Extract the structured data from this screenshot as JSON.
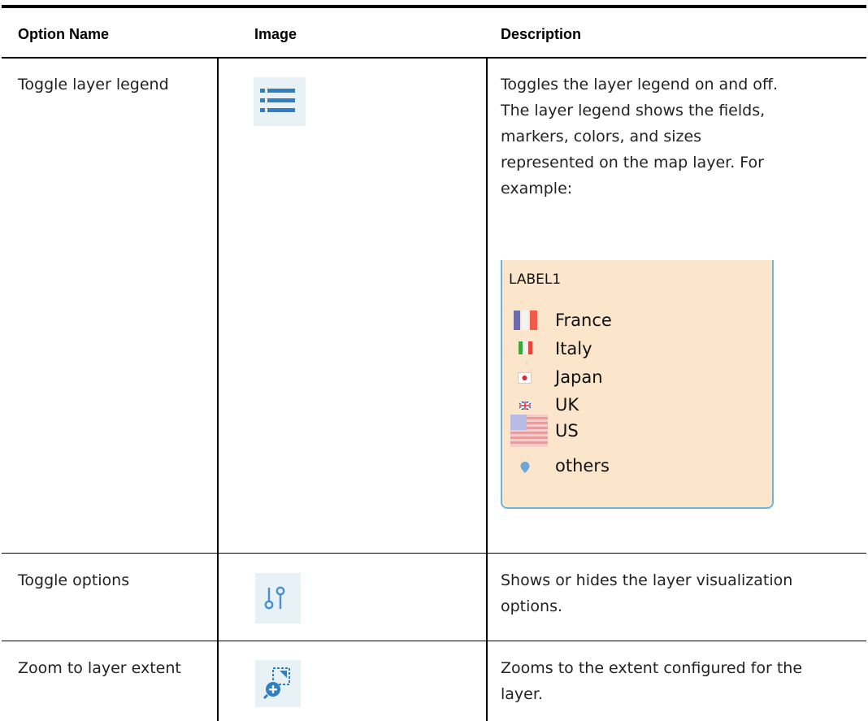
{
  "table": {
    "headers": {
      "option_name": "Option Name",
      "image": "Image",
      "description": "Description"
    },
    "rows": [
      {
        "option_name": "Toggle layer legend",
        "icon": "list-icon",
        "description_lines": [
          "Toggles the layer legend on and off.",
          "The layer legend shows the fields,",
          "markers, colors, and sizes",
          "represented on the map layer. For",
          "example:"
        ]
      },
      {
        "option_name": "Toggle options",
        "icon": "options-icon",
        "description_lines": [
          "Shows or hides the layer visualization",
          "options."
        ]
      },
      {
        "option_name": "Zoom to layer extent",
        "icon": "zoom-extent-icon",
        "description_lines": [
          "Zooms to the extent configured for the",
          "layer."
        ]
      }
    ]
  },
  "legend_example": {
    "title": "LABEL1",
    "items": [
      {
        "label": "France",
        "marker": "france-flag-icon"
      },
      {
        "label": "Italy",
        "marker": "italy-flag-icon"
      },
      {
        "label": "Japan",
        "marker": "japan-flag-icon"
      },
      {
        "label": "UK",
        "marker": "uk-flag-icon"
      },
      {
        "label": "US",
        "marker": "us-flag-icon"
      },
      {
        "label": "others",
        "marker": "map-pin-icon"
      }
    ]
  },
  "colors": {
    "icon_blue": "#2f7fc1",
    "icon_bg": "#e8f1f5",
    "legend_bg": "#fbe6cc",
    "legend_border": "#6ab7dd"
  }
}
